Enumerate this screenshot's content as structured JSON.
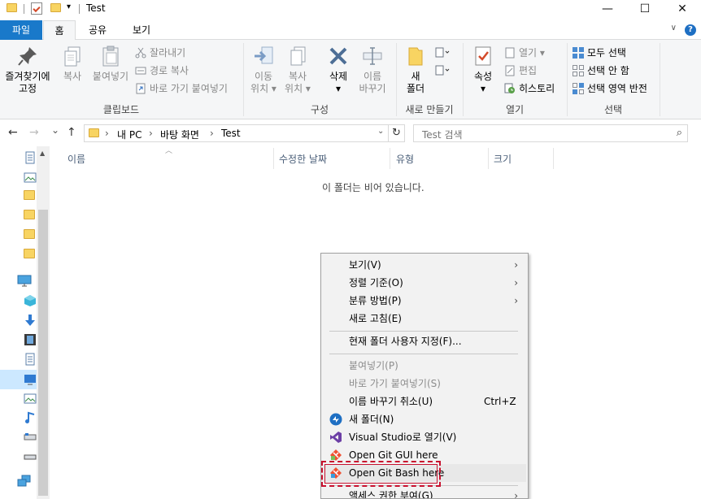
{
  "window": {
    "title": "Test",
    "minimize": "—",
    "maximize": "☐",
    "close": "✕",
    "qa_dropdown": "▾"
  },
  "tabs": {
    "file": "파일",
    "home": "홈",
    "share": "공유",
    "view": "보기",
    "collapse": "∨",
    "help": "?"
  },
  "ribbon": {
    "clipboard": {
      "label": "클립보드",
      "pin": "즐겨찾기에\n고정",
      "copy": "복사",
      "paste": "붙여넣기",
      "cut": "잘라내기",
      "copy_path": "경로 복사",
      "paste_shortcut": "바로 가기 붙여넣기"
    },
    "organize": {
      "label": "구성",
      "move_to": "이동\n위치 ▾",
      "copy_to": "복사\n위치 ▾",
      "delete": "삭제\n▾",
      "rename": "이름\n바꾸기"
    },
    "new": {
      "label": "새로 만들기",
      "new_folder": "새\n폴더"
    },
    "open": {
      "label": "열기",
      "properties": "속성\n▾",
      "open": "열기 ▾",
      "edit": "편집",
      "history": "히스토리"
    },
    "select": {
      "label": "선택",
      "select_all": "모두 선택",
      "select_none": "선택 안 함",
      "invert": "선택 영역 반전"
    }
  },
  "address": {
    "back": "←",
    "forward": "→",
    "recent": "⌄",
    "up": "↑",
    "path": [
      "내 PC",
      "바탕 화면",
      "Test"
    ],
    "sep": "›",
    "refresh": "↻",
    "search_placeholder": "Test 검색",
    "search_icon": "⌕"
  },
  "columns": {
    "name": "이름",
    "date": "수정한 날짜",
    "type": "유형",
    "size": "크기"
  },
  "empty_message": "이 폴더는 비어 있습니다.",
  "context_menu": {
    "view": "보기(V)",
    "sort": "정렬 기준(O)",
    "group": "분류 방법(P)",
    "refresh": "새로 고침(E)",
    "customize": "현재 폴더 사용자 지정(F)...",
    "paste": "붙여넣기(P)",
    "paste_shortcut": "바로 가기 붙여넣기(S)",
    "undo_rename": "이름 바꾸기 취소(U)",
    "undo_shortcut": "Ctrl+Z",
    "new_folder": "새 폴더(N)",
    "vs_open": "Visual Studio로 열기(V)",
    "git_gui": "Open Git GUI here",
    "git_bash": "Open Git Bash here",
    "access": "액세스 권한 부여(G)",
    "submenu_arrow": "›"
  },
  "colors": {
    "accent": "#1979ca",
    "highlight_box": "#c8102e",
    "nav_selected": "#cce8ff"
  }
}
